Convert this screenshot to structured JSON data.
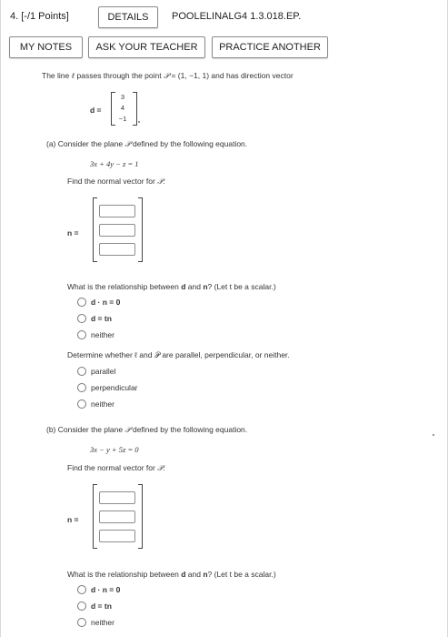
{
  "header": {
    "question_number": "4.  [-/1 Points]",
    "details_button": "DETAILS",
    "problem_id": "POOLELINALG4 1.3.018.EP."
  },
  "toolbar": {
    "my_notes": "MY NOTES",
    "ask_teacher": "ASK YOUR TEACHER",
    "practice_another": "PRACTICE ANOTHER"
  },
  "intro": {
    "text_before": "The line ",
    "line_symbol": "ℓ",
    "text_middle": " passes through the point ",
    "point_symbol": "𝒫",
    "point_value": " = (1, −1, 1) and has direction vector",
    "d_label": "d =",
    "d_vector": [
      "3",
      "4",
      "−1"
    ]
  },
  "part_a": {
    "label": "(a)  Consider the plane ",
    "plane_symbol": "𝒫",
    "label_after": " defined by the following equation.",
    "equation": "3x + 4y − z = 1",
    "find_normal": "Find the normal vector for ",
    "n_label": "n =",
    "relationship_question": "What is the relationship between ",
    "relationship_d": "d",
    "relationship_and": " and ",
    "relationship_n": "n",
    "relationship_tail": "? (Let t be a scalar.)",
    "relationship_options": [
      "d · n = 0",
      "d = tn",
      "neither"
    ],
    "parallel_question": "Determine whether ℓ and 𝒫 are parallel, perpendicular, or neither.",
    "parallel_options": [
      "parallel",
      "perpendicular",
      "neither"
    ]
  },
  "part_b": {
    "label": "(b)  Consider the plane ",
    "plane_symbol": "𝒫",
    "label_after": " defined by the following equation.",
    "equation": "3x − y + 5z = 0",
    "find_normal": "Find the normal vector for ",
    "n_label": "n =",
    "relationship_question": "What is the relationship between ",
    "relationship_d": "d",
    "relationship_and": " and ",
    "relationship_n": "n",
    "relationship_tail": "? (Let t be a scalar.)",
    "relationship_options": [
      "d · n = 0",
      "d = tn",
      "neither"
    ]
  }
}
